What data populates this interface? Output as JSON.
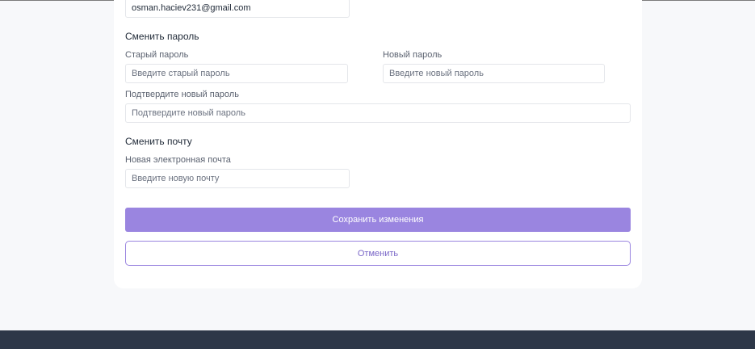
{
  "account": {
    "current_email_value": "osman.haciev231@gmail.com"
  },
  "password_section": {
    "title": "Сменить пароль",
    "old_password_label": "Старый пароль",
    "old_password_placeholder": "Введите старый пароль",
    "new_password_label": "Новый пароль",
    "new_password_placeholder": "Введите новый пароль",
    "confirm_password_label": "Подтвердите новый пароль",
    "confirm_password_placeholder": "Подтвердите новый пароль"
  },
  "email_section": {
    "title": "Сменить почту",
    "new_email_label": "Новая электронная почта",
    "new_email_placeholder": "Введите новую почту"
  },
  "actions": {
    "save_label": "Сохранить изменения",
    "cancel_label": "Отменить"
  },
  "colors": {
    "accent": "#9a85e0",
    "accent_text": "#7b68c8",
    "footer": "#2d3748",
    "page_background": "#f7f8fa"
  }
}
